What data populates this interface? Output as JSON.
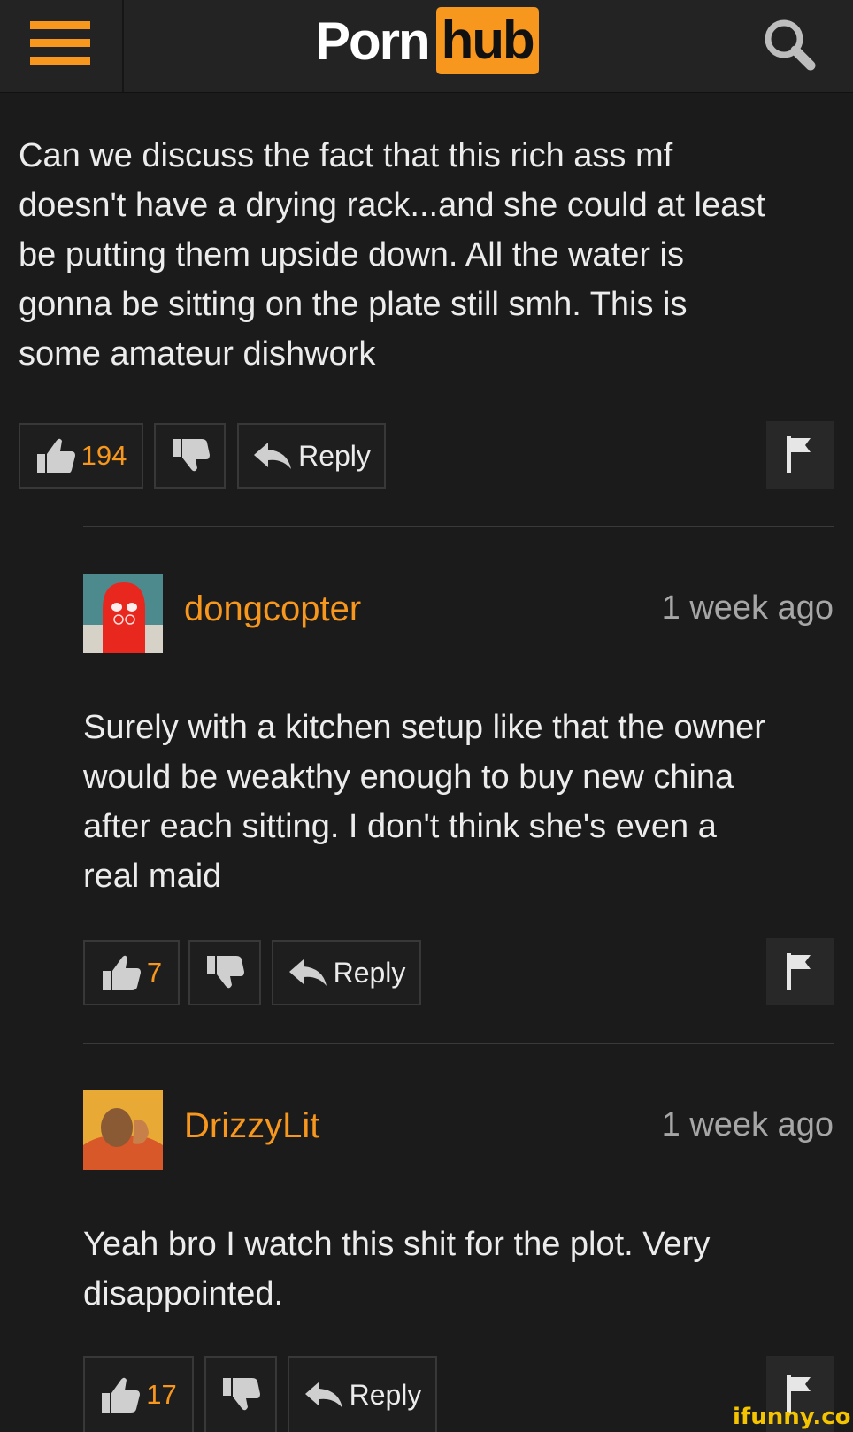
{
  "header": {
    "logo_left": "Porn",
    "logo_right": "hub",
    "menu_icon": "hamburger-menu-icon",
    "search_icon": "search-icon"
  },
  "comments": [
    {
      "text": "Can we discuss the fact that this rich ass mf\ndoesn't have a drying rack...and she could at least\nbe putting them upside down. All the water is\ngonna be sitting on the plate still smh. This is\nsome amateur dishwork",
      "likes": "194",
      "reply_label": "Reply"
    },
    {
      "username": "dongcopter",
      "time": "1 week ago",
      "text": "Surely with a kitchen setup like that the owner\nwould be weakthy enough to buy new china\nafter each sitting. I don't think she's even a\nreal maid",
      "likes": "7",
      "reply_label": "Reply"
    },
    {
      "username": "DrizzyLit",
      "time": "1 week ago",
      "text": "Yeah bro I watch this shit for the plot. Very\ndisappointed.",
      "likes": "17",
      "reply_label": "Reply"
    }
  ],
  "watermark": "ifunny.co",
  "colors": {
    "accent": "#f7971d",
    "background": "#1b1b1b",
    "text": "#ececec",
    "muted": "#a6a6a6"
  }
}
